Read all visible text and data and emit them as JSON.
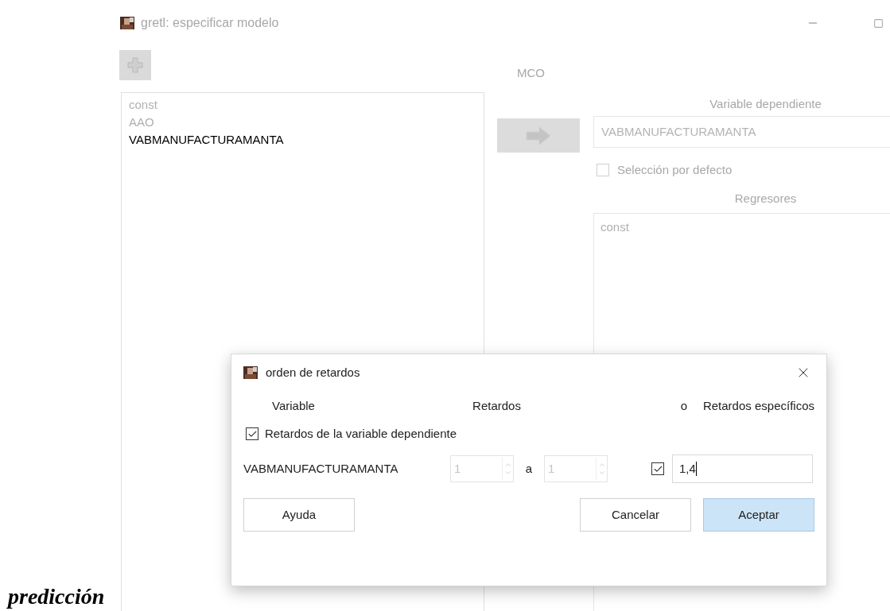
{
  "background_text": {
    "text": "predicción"
  },
  "window": {
    "title": "gretl: especificar modelo",
    "estimator": "MCO",
    "variables": [
      {
        "name": "const",
        "disabled": true
      },
      {
        "name": "AAO",
        "disabled": true
      },
      {
        "name": "VABMANUFACTURAMANTA",
        "disabled": false
      }
    ],
    "dependent": {
      "label": "Variable dependiente",
      "value": "VABMANUFACTURAMANTA"
    },
    "default_selection": {
      "label": "Selección por defecto",
      "checked": false
    },
    "regressors": {
      "label": "Regresores",
      "items": [
        "const"
      ]
    }
  },
  "dialog": {
    "title": "orden de retardos",
    "headers": [
      "Variable",
      "Retardos",
      "o",
      "Retardos específicos"
    ],
    "dep_lags": {
      "label": "Retardos de la variable dependiente",
      "checked": true
    },
    "row": {
      "variable": "VABMANUFACTURAMANTA",
      "from": "1",
      "separator": "a",
      "to": "1",
      "specific_checked": true,
      "specific": "1,4"
    },
    "buttons": [
      {
        "label": "Ayuda",
        "default": false
      },
      {
        "label": "Cancelar",
        "default": false
      },
      {
        "label": "Aceptar",
        "default": true
      }
    ]
  }
}
